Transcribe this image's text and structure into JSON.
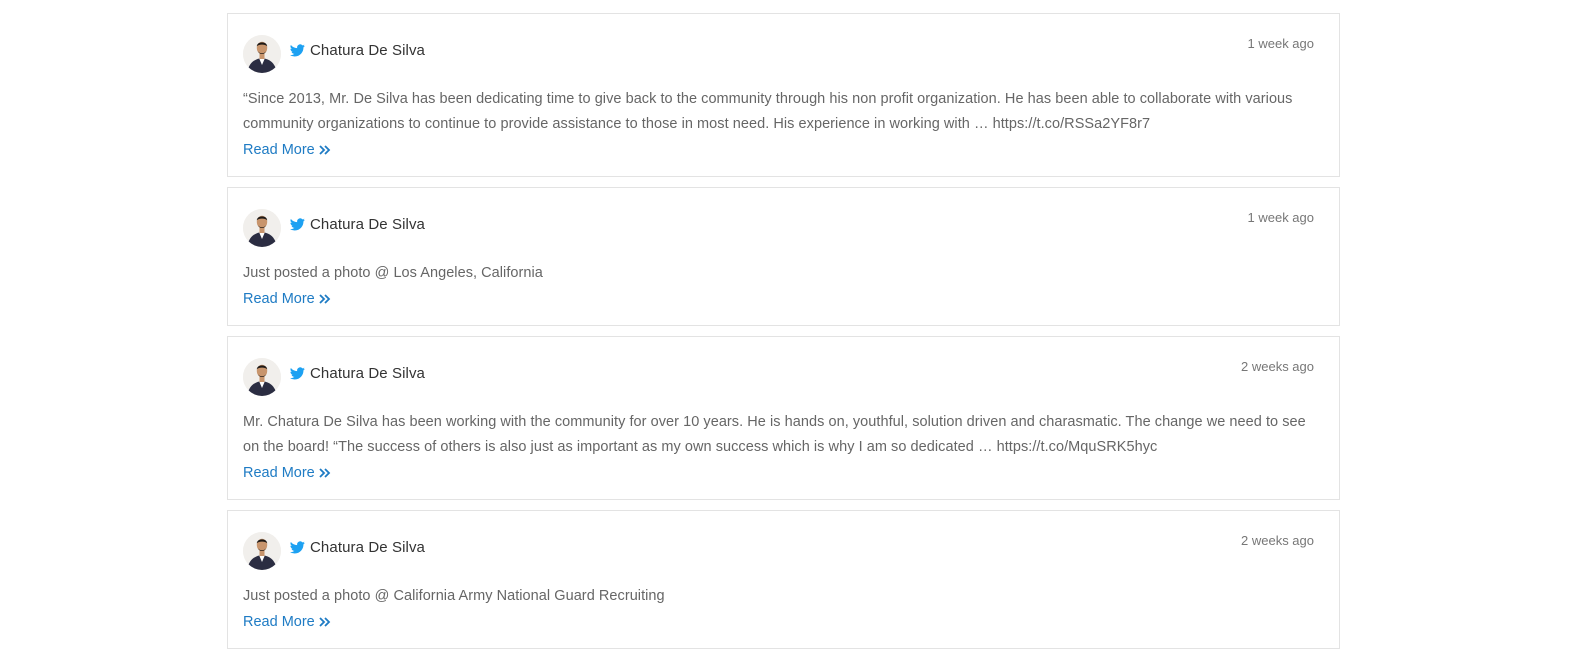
{
  "colors": {
    "twitter": "#1da1f2",
    "link": "#1e7bc4",
    "text": "#666666",
    "author": "#333333"
  },
  "posts": [
    {
      "author": "Chatura De Silva",
      "time": "1 week ago",
      "text": "“Since 2013, Mr. De Silva has been dedicating time to give back to the community through his non profit organization. He has been able to collaborate with various community organizations to continue to provide assistance to those in most need. His experience in working with … https://t.co/RSSa2YF8r7",
      "read_more": "Read More"
    },
    {
      "author": "Chatura De Silva",
      "time": "1 week ago",
      "text": "Just posted a photo @ Los Angeles, California",
      "read_more": "Read More"
    },
    {
      "author": "Chatura De Silva",
      "time": "2 weeks ago",
      "text": "Mr. Chatura De Silva has been working with the community for over 10 years. He is hands on, youthful, solution driven and charasmatic. The change we need to see on the board! “The success of others is also just as important as my own success which is why I am so dedicated … https://t.co/MquSRK5hyc",
      "read_more": "Read More"
    },
    {
      "author": "Chatura De Silva",
      "time": "2 weeks ago",
      "text": "Just posted a photo @ California Army National Guard Recruiting",
      "read_more": "Read More"
    }
  ],
  "icons": {
    "network": "twitter-icon",
    "read_more": "double-chevron-right-icon"
  }
}
